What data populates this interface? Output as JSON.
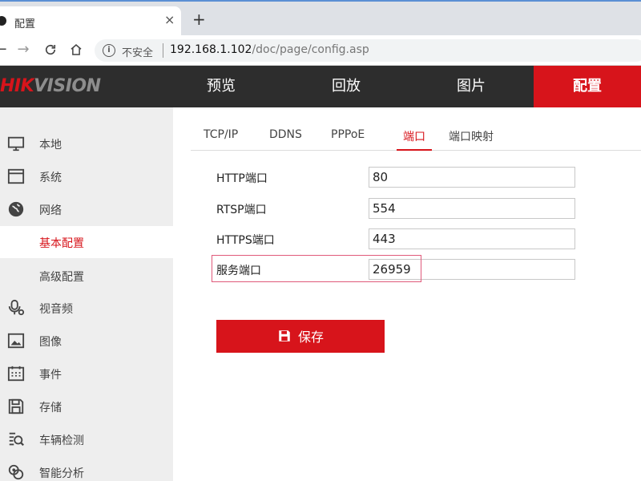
{
  "browser": {
    "tab_title": "配置",
    "insecure_label": "不安全",
    "url_host": "192.168.1.102",
    "url_path": "/doc/page/config.asp"
  },
  "header": {
    "logo_hik": "HIK",
    "logo_vision": "VISION",
    "nav": {
      "preview": "预览",
      "playback": "回放",
      "picture": "图片",
      "config": "配置"
    }
  },
  "sidebar": {
    "items": [
      {
        "label": "本地",
        "icon": "monitor-icon"
      },
      {
        "label": "系统",
        "icon": "window-icon"
      },
      {
        "label": "网络",
        "icon": "globe-icon"
      },
      {
        "label": "基本配置",
        "icon": ""
      },
      {
        "label": "高级配置",
        "icon": ""
      },
      {
        "label": "视音频",
        "icon": "microphone-icon"
      },
      {
        "label": "图像",
        "icon": "image-icon"
      },
      {
        "label": "事件",
        "icon": "calendar-icon"
      },
      {
        "label": "存储",
        "icon": "disk-icon"
      },
      {
        "label": "车辆检测",
        "icon": "car-search-icon"
      },
      {
        "label": "智能分析",
        "icon": "smart-analysis-icon"
      }
    ],
    "active_index": 3
  },
  "subtabs": {
    "tcpip": "TCP/IP",
    "ddns": "DDNS",
    "pppoe": "PPPoE",
    "port": "端口",
    "port_mapping": "端口映射"
  },
  "form": {
    "http_label": "HTTP端口",
    "http_value": "80",
    "rtsp_label": "RTSP端口",
    "rtsp_value": "554",
    "https_label": "HTTPS端口",
    "https_value": "443",
    "service_label": "服务端口",
    "service_value": "26959"
  },
  "save_label": "保存",
  "colors": {
    "brand_red": "#d7141b",
    "header_dark": "#2d2d2d",
    "sidebar_bg": "#eeeeee",
    "highlight": "#e05a7a"
  }
}
